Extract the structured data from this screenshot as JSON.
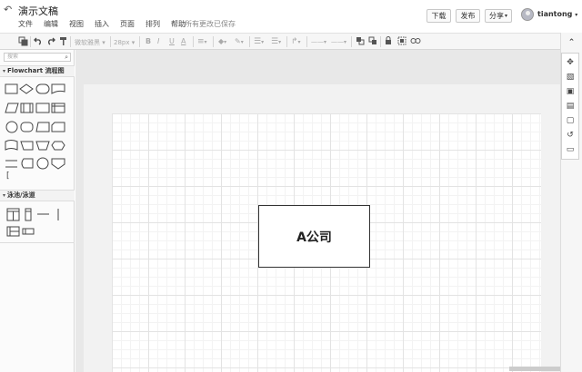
{
  "header": {
    "back": "↶",
    "title": "演示文稿",
    "menu": [
      "文件",
      "编辑",
      "视图",
      "插入",
      "页面",
      "排列",
      "帮助"
    ],
    "save_status": "所有更改已保存",
    "download": "下载",
    "publish": "发布",
    "share": "分享",
    "share_caret": "▾",
    "username": "tiantong",
    "user_caret": "▾"
  },
  "toolbar": {
    "font_placeholder": "微软雅黑",
    "font_size": "28px",
    "bold": "B",
    "italic": "I",
    "underline": "U",
    "font_color": "A",
    "align": "≡",
    "fill": "◆",
    "line_color": "✎",
    "list": "☰",
    "connector": "↱",
    "line_style": "——",
    "arrow_style": "——",
    "collapse": "»"
  },
  "sidebar": {
    "search_placeholder": "搜索",
    "search_icon": "⌕",
    "sections": [
      {
        "name": "Flowchart 流程图",
        "caret": "▾"
      },
      {
        "name": "泳池/泳道",
        "caret": "▾"
      }
    ],
    "bracket_glyph": "["
  },
  "canvas": {
    "box_label": "A公司"
  },
  "right_panel": {
    "icons": [
      "compass-icon",
      "format-icon",
      "page-icon",
      "data-icon",
      "file-icon",
      "history-icon",
      "comment-icon"
    ],
    "glyphs": {
      "collapse": "⌃",
      "compass": "✥",
      "format": "▧",
      "page": "▣",
      "data": "▤",
      "file": "▢",
      "history": "↺",
      "comment": "▭"
    }
  },
  "colors": {
    "canvas_bg": "#e8e8e8",
    "paper": "#ffffff",
    "grid": "#e3e3e3",
    "toolbar_bg": "#f6f6f6"
  }
}
